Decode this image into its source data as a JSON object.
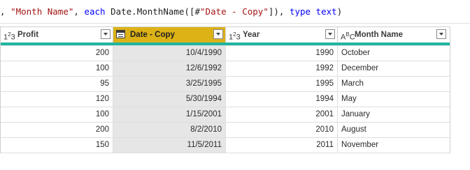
{
  "formula": {
    "p1": ", ",
    "s1": "\"Month Name\"",
    "p2": ", ",
    "k1": "each",
    "p3": " Date.MonthName([#",
    "s2": "\"Date - Copy\"",
    "p4": "]), ",
    "k2": "type",
    "p5": " ",
    "k3": "text",
    "p6": ")"
  },
  "columns": [
    {
      "label": "Profit",
      "type_icon": "number-type-icon",
      "type_text": "1",
      "type_sup": "2",
      "type_text2": "3",
      "align": "num"
    },
    {
      "label": "Date - Copy",
      "type_icon": "calendar-icon",
      "align": "num",
      "selected": true
    },
    {
      "label": "Year",
      "type_icon": "number-type-icon",
      "type_text": "1",
      "type_sup": "2",
      "type_text2": "3",
      "align": "num"
    },
    {
      "label": "Month Name",
      "type_icon": "text-type-icon",
      "type_text": "A",
      "type_sup": "B",
      "type_text2": "C",
      "align": "text"
    }
  ],
  "rows": [
    [
      "200",
      "10/4/1990",
      "1990",
      "October"
    ],
    [
      "100",
      "12/6/1992",
      "1992",
      "December"
    ],
    [
      "95",
      "3/25/1995",
      "1995",
      "March"
    ],
    [
      "120",
      "5/30/1994",
      "1994",
      "May"
    ],
    [
      "100",
      "1/15/2001",
      "2001",
      "January"
    ],
    [
      "200",
      "8/2/2010",
      "2010",
      "August"
    ],
    [
      "150",
      "11/5/2011",
      "2011",
      "November"
    ]
  ],
  "colors": {
    "selected_header": "#dcb217",
    "selected_column": "#e6e6e6",
    "quality_bar": "#1fb5a0",
    "string_token": "#a31515",
    "keyword_token": "#0000ff"
  }
}
